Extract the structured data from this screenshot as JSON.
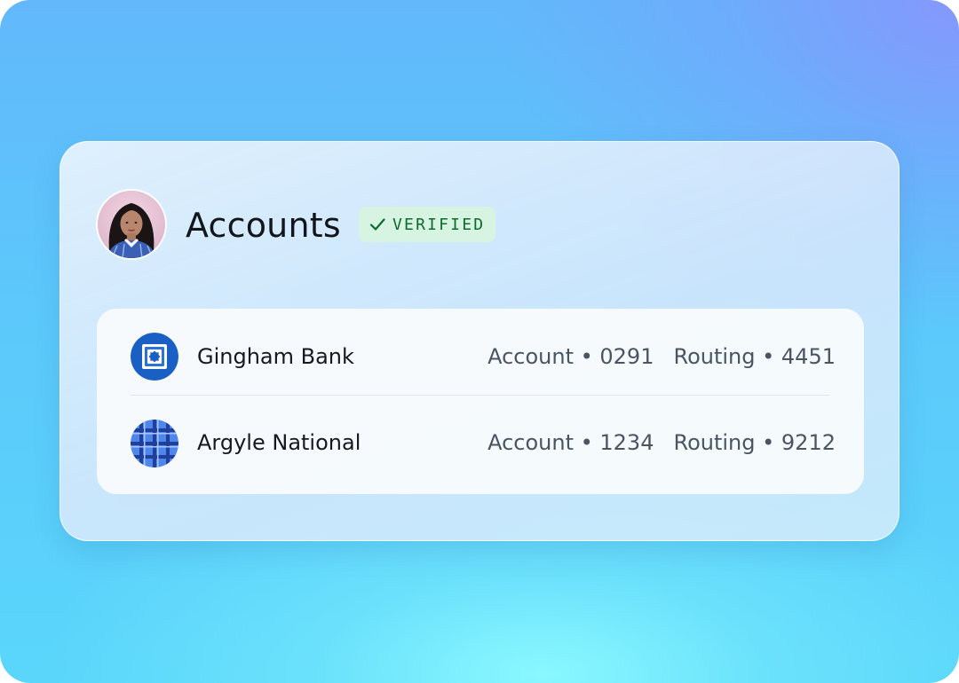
{
  "card": {
    "title": "Accounts",
    "badge": {
      "label": "VERIFIED",
      "icon": "checkmark-icon",
      "color": "#0f6a2e",
      "background": "#d6f4e1"
    }
  },
  "accounts": [
    {
      "bank_name": "Gingham Bank",
      "logo_icon": "gingham-bank-logo-icon",
      "account_label": "Account • 0291",
      "routing_label": "Routing • 4451"
    },
    {
      "bank_name": "Argyle National",
      "logo_icon": "argyle-national-logo-icon",
      "account_label": "Account • 1234",
      "routing_label": "Routing • 9212"
    }
  ],
  "colors": {
    "background_top": "#62b8fb",
    "background_bottom": "#5ad6fb",
    "gingham_blue": "#1a5fc4",
    "argyle_blue": "#3f78e6"
  }
}
